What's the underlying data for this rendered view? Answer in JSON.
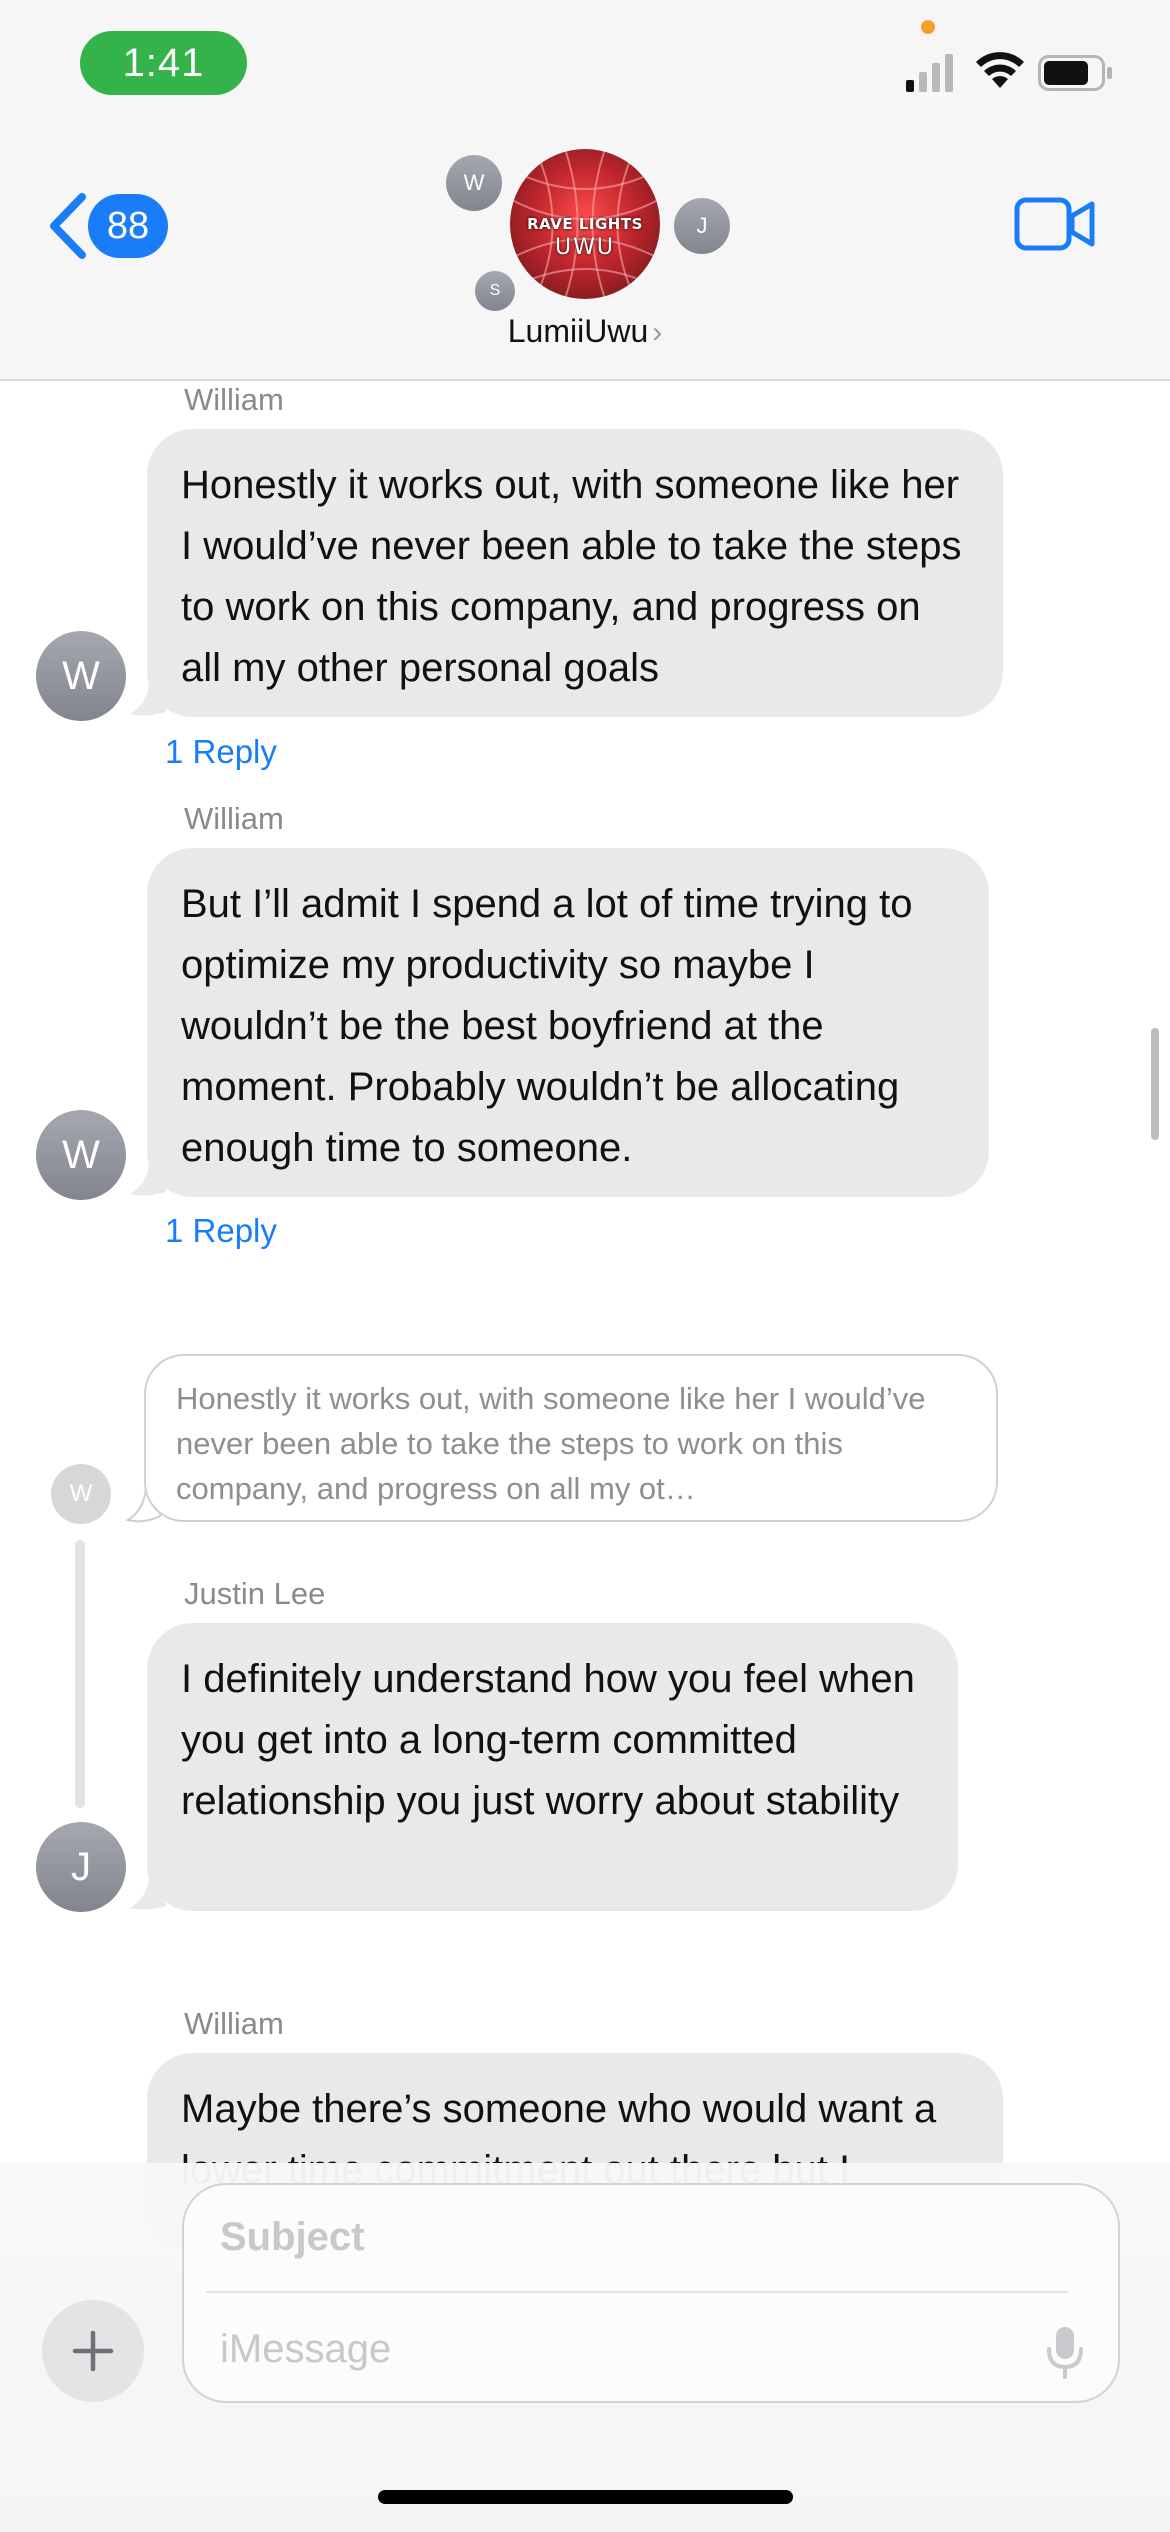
{
  "status_bar": {
    "time": "1:41"
  },
  "header": {
    "back_count": "88",
    "group_name": "LumiiUwu",
    "group_chevron": "›",
    "avatar_text_top": "RAVE LIGHTS",
    "avatar_text_bottom": "UWU",
    "participants": [
      "W",
      "J",
      "S"
    ]
  },
  "messages": [
    {
      "sender": "William",
      "avatar": "W",
      "text": "Honestly it works out, with someone like her I would’ve never been able to take the steps to work on this company, and progress on all my other personal goals",
      "reply_label": "1 Reply"
    },
    {
      "sender": "William",
      "avatar": "W",
      "text": "But I’ll admit I spend a lot of time trying to optimize my productivity so maybe I wouldn’t be the best boyfriend at the moment. Probably wouldn’t be allocating enough time to someone.",
      "reply_label": "1 Reply"
    },
    {
      "quoted_avatar": "W",
      "quoted_text": "Honestly it works out, with someone like her I would’ve never been able to take  the steps to work on this company, and progress on all my ot…",
      "sender": "Justin Lee",
      "avatar": "J",
      "text": "I definitely understand how you feel when you get into a long-term committed relationship you just worry about stability"
    },
    {
      "sender": "William",
      "text": "Maybe there’s someone who would want a lower time commitment out there but I"
    }
  ],
  "composer": {
    "subject_placeholder": "Subject",
    "message_placeholder": "iMessage"
  },
  "icons": {
    "back": "chevron-left-icon",
    "video": "video-camera-icon",
    "plus": "plus-icon",
    "mic": "microphone-icon",
    "signal": "cellular-signal-icon",
    "wifi": "wifi-icon",
    "battery": "battery-icon"
  },
  "colors": {
    "accent_blue": "#1a7df7",
    "time_pill_green": "#34b34a",
    "bubble_gray": "#e9e9eb"
  }
}
